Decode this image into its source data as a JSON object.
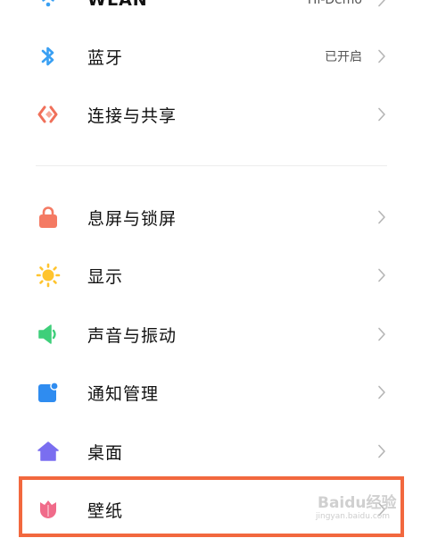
{
  "settings": {
    "network_group": [
      {
        "label": "WLAN",
        "value": "Hi-Demo",
        "icon": "wifi-icon"
      },
      {
        "label": "蓝牙",
        "value": "已开启",
        "icon": "bluetooth-icon"
      },
      {
        "label": "连接与共享",
        "value": "",
        "icon": "connection-share-icon"
      }
    ],
    "device_group": [
      {
        "label": "息屏与锁屏",
        "icon": "lock-icon"
      },
      {
        "label": "显示",
        "icon": "sun-icon"
      },
      {
        "label": "声音与振动",
        "icon": "speaker-icon"
      },
      {
        "label": "通知管理",
        "icon": "notification-icon"
      },
      {
        "label": "桌面",
        "icon": "home-icon"
      },
      {
        "label": "壁纸",
        "icon": "tulip-icon"
      }
    ]
  },
  "colors": {
    "highlight_border": "#f2683e",
    "wifi": "#3aa0f3",
    "bluetooth": "#3aa0f3",
    "connection": "#f0705a",
    "lock": "#f47a63",
    "sun": "#ffc42e",
    "speaker": "#3ecf7a",
    "notification": "#2f8cf0",
    "home": "#7a6ef0",
    "tulip": "#f06b8a"
  },
  "watermark": {
    "main": "Baidu经验",
    "sub": "jingyan.baidu.com"
  }
}
